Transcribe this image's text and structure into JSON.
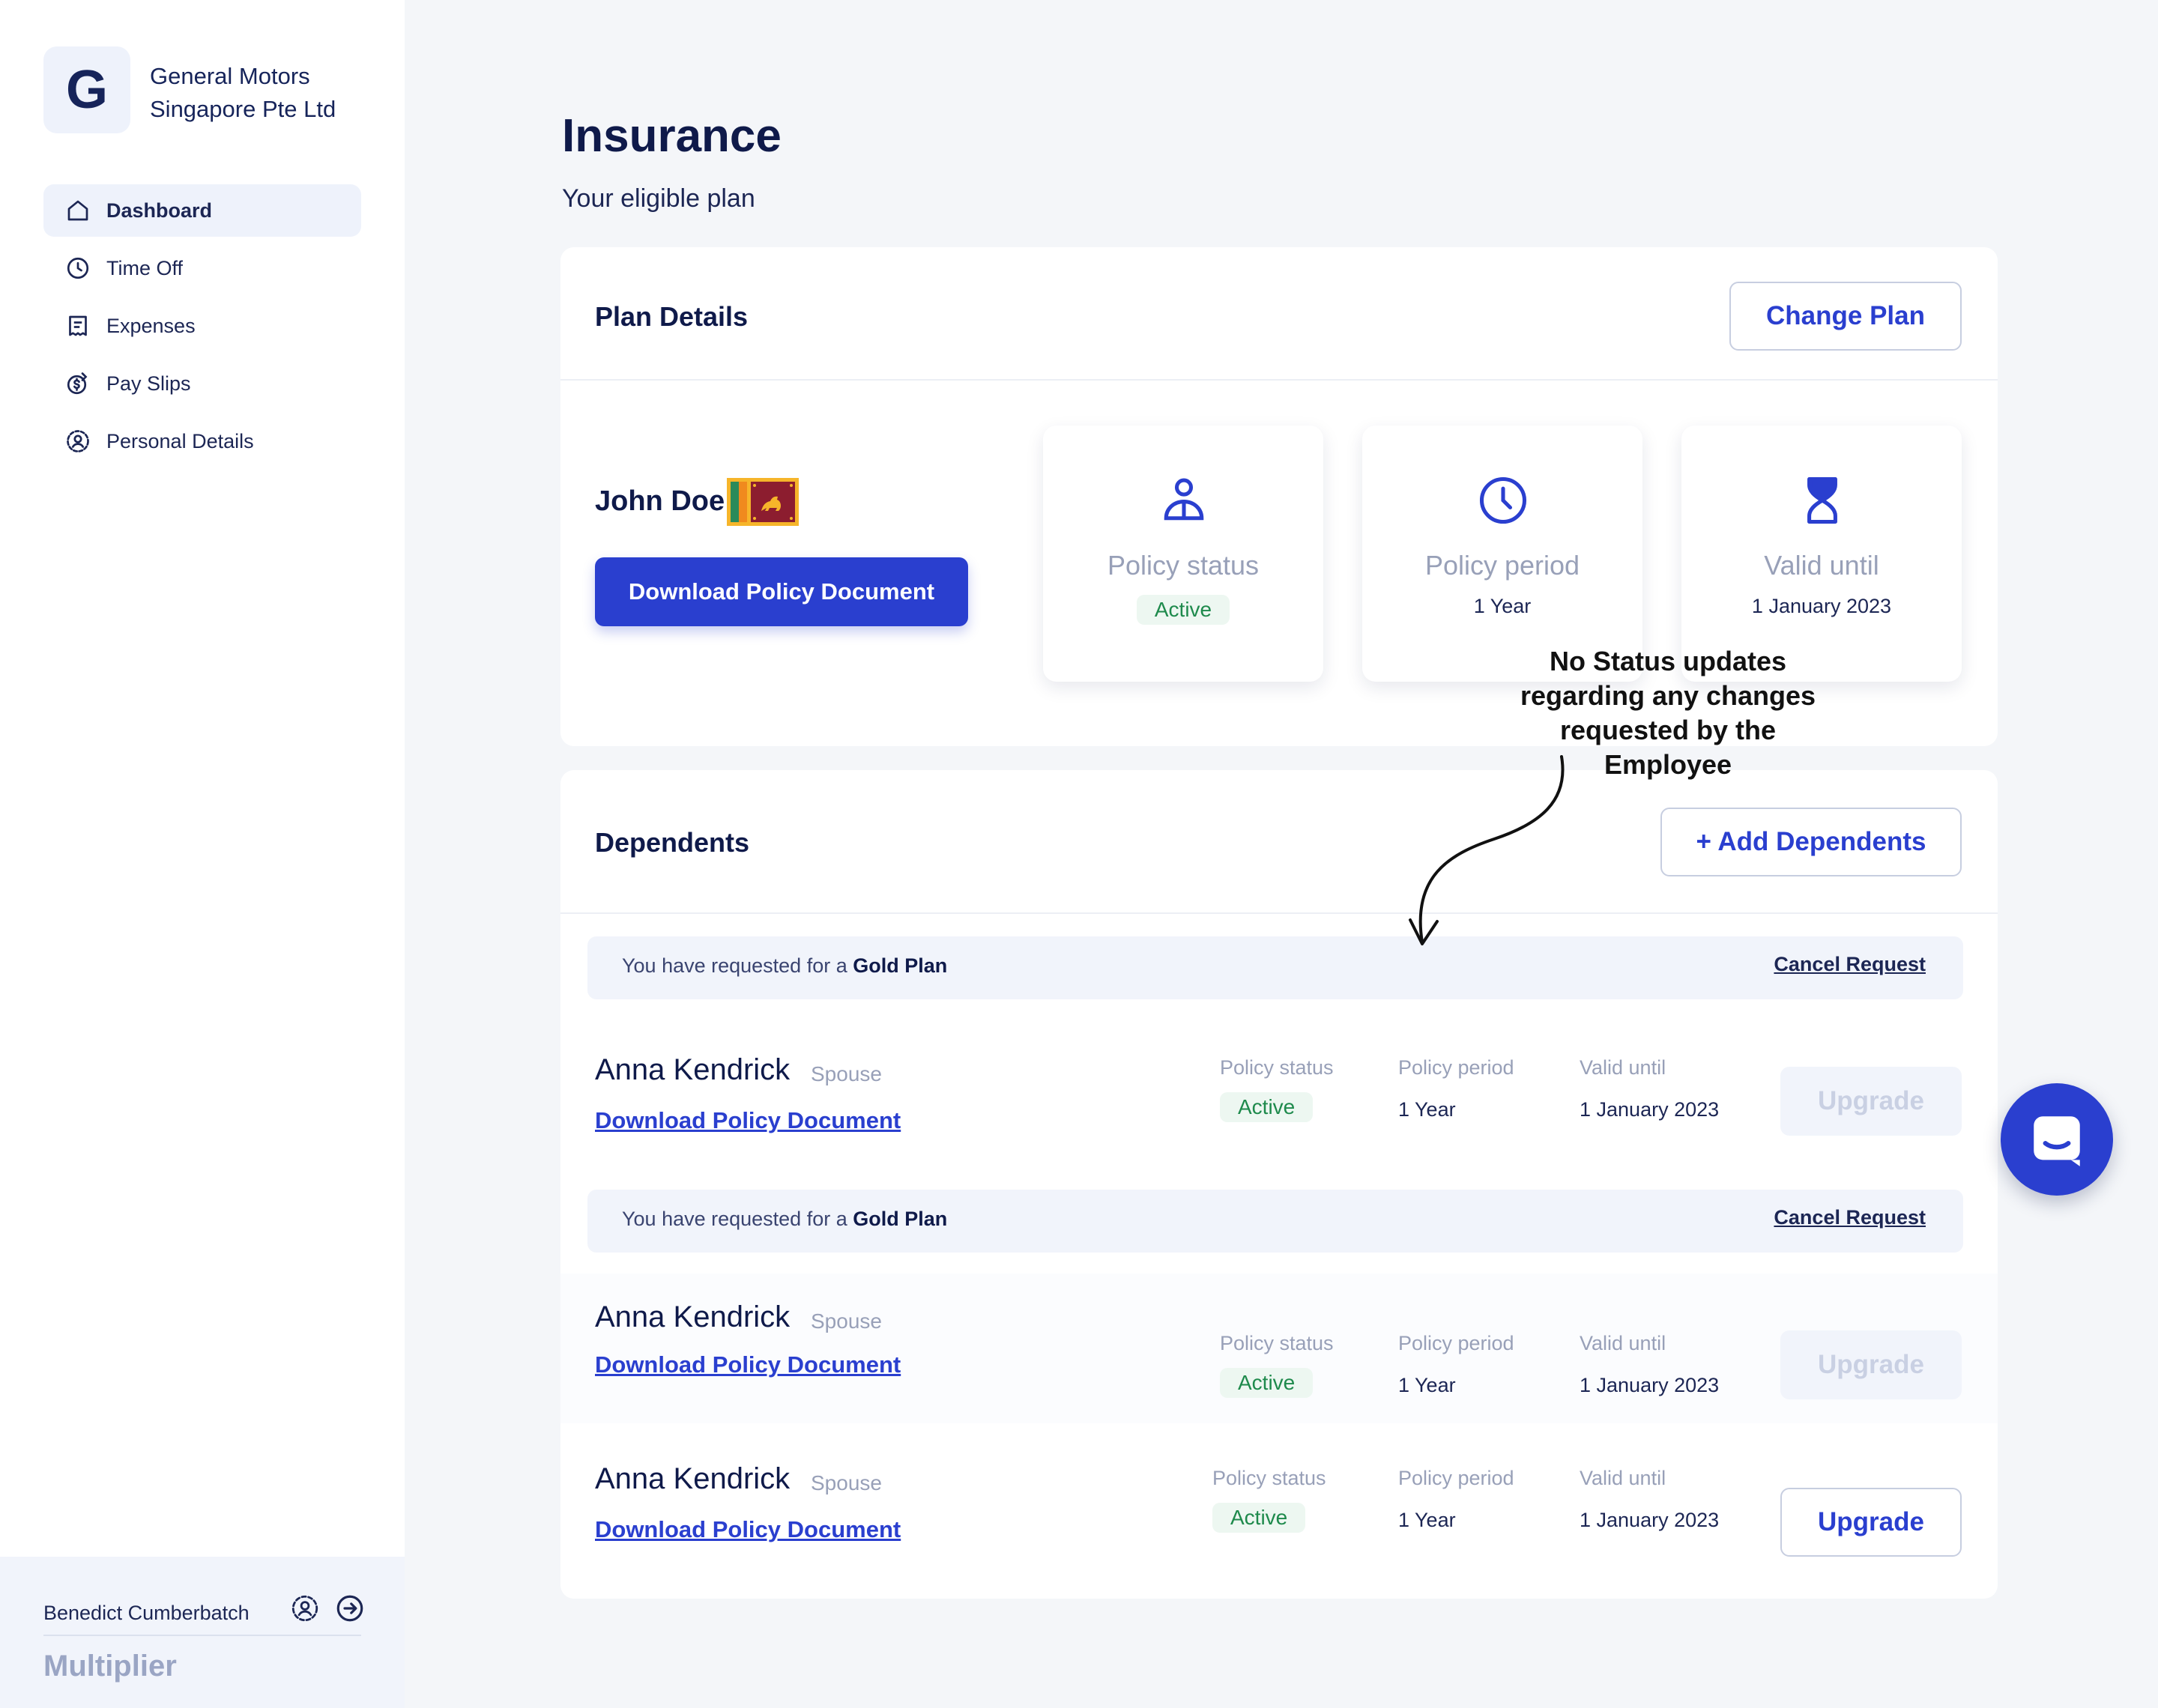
{
  "sidebar": {
    "logo_letter": "G",
    "company": "General Motors Singapore Pte Ltd",
    "nav": [
      {
        "label": "Dashboard",
        "icon": "home-icon",
        "active": true
      },
      {
        "label": "Time Off",
        "icon": "clock-icon"
      },
      {
        "label": "Expenses",
        "icon": "receipt-icon"
      },
      {
        "label": "Pay Slips",
        "icon": "payslip-icon"
      },
      {
        "label": "Personal Details",
        "icon": "user-circle-icon"
      }
    ],
    "user_name": "Benedict Cumberbatch",
    "brand": "Multiplier"
  },
  "header": {
    "title": "Insurance",
    "subtitle": "Your eligible plan"
  },
  "plan": {
    "title": "Plan Details",
    "change_plan_label": "Change Plan",
    "employee_name": "John Doe",
    "download_label": "Download Policy Document",
    "stats": [
      {
        "label": "Policy status",
        "value": "Active",
        "icon": "person-icon"
      },
      {
        "label": "Policy period",
        "value": "1 Year",
        "icon": "clock-icon"
      },
      {
        "label": "Valid until",
        "value": "1 January 2023",
        "icon": "hourglass-icon"
      }
    ]
  },
  "annotation": "No Status updates regarding any changes requested by the Employee",
  "dependents": {
    "title": "Dependents",
    "add_label": "+ Add Dependents",
    "request_prefix": "You have requested for a ",
    "request_plan": "Gold Plan",
    "cancel_label": "Cancel Request",
    "col_status": "Policy status",
    "col_period": "Policy period",
    "col_valid": "Valid until",
    "rows": [
      {
        "name": "Anna Kendrick",
        "relation": "Spouse",
        "link": "Download Policy Document",
        "status": "Active",
        "period": "1 Year",
        "valid": "1 January 2023",
        "button": "Upgrade",
        "button_enabled": false,
        "requested": true
      },
      {
        "name": "Anna Kendrick",
        "relation": "Spouse",
        "link": "Download Policy Document",
        "status": "Active",
        "period": "1 Year",
        "valid": "1 January 2023",
        "button": "Upgrade",
        "button_enabled": false,
        "requested": true
      },
      {
        "name": "Anna Kendrick",
        "relation": "Spouse",
        "link": "Download Policy Document",
        "status": "Active",
        "period": "1 Year",
        "valid": "1 January 2023",
        "button": "Upgrade",
        "button_enabled": true,
        "requested": false
      }
    ]
  },
  "colors": {
    "accent": "#2a3fcf",
    "text_dark": "#0f1a4a",
    "muted": "#98a0b8",
    "success": "#1e8a4c"
  },
  "chat_icon": "chat-bubble-icon"
}
